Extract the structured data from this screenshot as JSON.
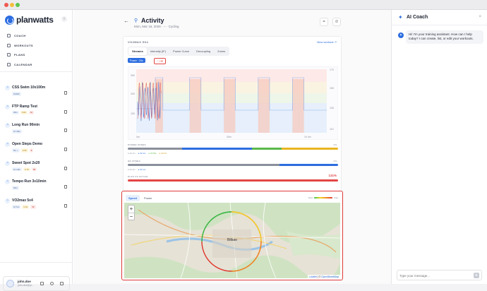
{
  "app": {
    "name": "planwatts"
  },
  "nav": [
    {
      "label": "COACH",
      "icon": "coach-icon"
    },
    {
      "label": "WORKOUTS",
      "icon": "workouts-icon"
    },
    {
      "label": "PLANS",
      "icon": "plans-icon"
    },
    {
      "label": "CALENDAR",
      "icon": "calendar-icon"
    }
  ],
  "workouts": [
    {
      "title": "CSS Swim 10x100m",
      "tags": [
        "1h00m"
      ],
      "y": "",
      "r": ""
    },
    {
      "title": "FTP Ramp Test",
      "tags": [
        "30m"
      ],
      "y": "0.82",
      "r": "62"
    },
    {
      "title": "Long Run 90min",
      "tags": [
        "1h 30m"
      ],
      "y": "",
      "r": ""
    },
    {
      "title": "Open Steps Demo",
      "tags": [
        "5m +"
      ],
      "y": "0.55",
      "r": "8"
    },
    {
      "title": "Sweet Spot 2x20",
      "tags": [
        "1h 10m"
      ],
      "y": "0.76",
      "r": "58"
    },
    {
      "title": "Tempo Run 3x10min",
      "tags": [
        "54m"
      ],
      "y": "",
      "r": ""
    },
    {
      "title": "VO2max 5x4",
      "tags": [
        "1h 5m"
      ],
      "y": "0.64",
      "r": "66"
    }
  ],
  "user": {
    "name": "john.doe",
    "email": "john.doe@pl..."
  },
  "activity": {
    "back": "←",
    "title": "Activity",
    "subtitle": "Mon, Mar 16, 2026 · -- · Cycling",
    "workout_name": "VO2MAX 5X4",
    "view_link": "View workout ↗",
    "tabs": [
      "Streams",
      "Intensity (IF)",
      "Power Curve",
      "Decoupling",
      "Zones"
    ],
    "active_tab": 0,
    "power_pill": "Power · 20s",
    "hr_pill": "♡ HR"
  },
  "zones": {
    "power_label": "POWER ZONES",
    "power_right": "0%",
    "power_legend": [
      "Z1 1m",
      "Z2 4m",
      "Z3 54s",
      "Z4 3m"
    ],
    "hr_label": "HR ZONES",
    "hr_right": "0%",
    "hr_legend": [
      "Z1 4m",
      "Z2 1m"
    ],
    "plan_label": "PLAN VS ACTUAL",
    "plan_pct": "131%"
  },
  "chart_data": {
    "type": "line",
    "x_ticks": [
      "0m",
      "30m",
      "1h 0m"
    ],
    "y_left_ticks": [
      100,
      200,
      300
    ],
    "y_right_ticks": [
      110,
      130,
      150,
      170
    ],
    "series": [
      {
        "name": "Power",
        "color": "#4a79d8"
      },
      {
        "name": "HR",
        "color": "#e25a5a"
      }
    ],
    "intervals": [
      {
        "start": 0.1,
        "end": 0.14
      },
      {
        "start": 0.28,
        "end": 0.34
      },
      {
        "start": 0.46,
        "end": 0.52
      },
      {
        "start": 0.64,
        "end": 0.7
      },
      {
        "start": 0.82,
        "end": 0.88
      }
    ]
  },
  "map": {
    "tabs": [
      "Speed",
      "Power"
    ],
    "scale_left": "Slow",
    "scale_right": "Fast",
    "city": "Bilbao",
    "attribution_leaflet": "Leaflet",
    "attribution_osm": "OpenStreetMap",
    "zoom_in": "+",
    "zoom_out": "−"
  },
  "ai": {
    "title": "AI Coach",
    "close": "×",
    "message": "Hi! I'm your training assistant. How can I help today? I can create, list, or edit your workouts.",
    "placeholder": "Type your message...",
    "send": "➤"
  },
  "colors": {
    "accent": "#2c6de0",
    "alert": "#e34545"
  }
}
